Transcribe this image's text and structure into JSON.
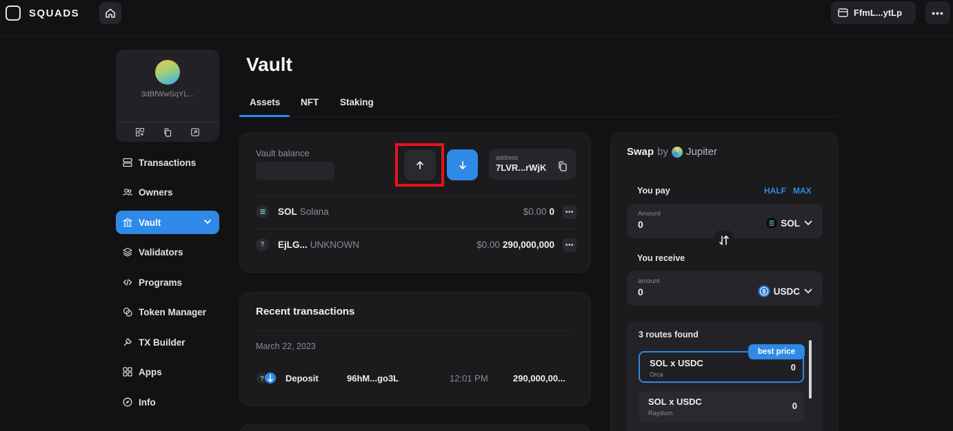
{
  "topbar": {
    "brand": "SQUADS",
    "wallet_label": "FfmL...ytLp"
  },
  "profile": {
    "address": "3dBfWwSqYL..."
  },
  "sidebar": {
    "items": [
      {
        "label": "Transactions",
        "icon": "stack-icon"
      },
      {
        "label": "Owners",
        "icon": "users-icon"
      },
      {
        "label": "Vault",
        "icon": "bank-icon"
      },
      {
        "label": "Validators",
        "icon": "layers-icon"
      },
      {
        "label": "Programs",
        "icon": "code-icon"
      },
      {
        "label": "Token Manager",
        "icon": "coins-icon"
      },
      {
        "label": "TX Builder",
        "icon": "wrench-icon"
      },
      {
        "label": "Apps",
        "icon": "grid-icon"
      },
      {
        "label": "Info",
        "icon": "compass-icon"
      }
    ],
    "active": "Vault"
  },
  "main": {
    "title": "Vault",
    "tabs": [
      {
        "label": "Assets"
      },
      {
        "label": "NFT"
      },
      {
        "label": "Staking"
      }
    ]
  },
  "balance_card": {
    "label": "Vault balance",
    "address_label": "address",
    "address_value": "7LVR...rWjK",
    "assets": [
      {
        "symbol": "SOL",
        "name": "Solana",
        "usd": "$0.00",
        "amount": "0",
        "icon_text": ""
      },
      {
        "symbol": "EjLG...",
        "name": "UNKNOWN",
        "usd": "$0.00",
        "amount": "290,000,000",
        "icon_text": "?"
      }
    ]
  },
  "recent": {
    "title": "Recent transactions",
    "date": "March 22, 2023",
    "rows": [
      {
        "type": "Deposit",
        "hash": "96hM...go3L",
        "time": "12:01 PM",
        "amount": "290,000,00..."
      }
    ]
  },
  "swap": {
    "title": "Swap",
    "by": "by",
    "provider": "Jupiter",
    "you_pay": "You pay",
    "half": "HALF",
    "max": "MAX",
    "pay_field_label": "Amount",
    "pay_value": "0",
    "pay_token": "SOL",
    "you_receive": "You receive",
    "receive_field_label": "amount",
    "receive_value": "0",
    "receive_token": "USDC",
    "routes_title": "3 routes found",
    "best_badge": "best price",
    "routes": [
      {
        "pair": "SOL x USDC",
        "dex": "Orca",
        "out": "0"
      },
      {
        "pair": "SOL x USDC",
        "dex": "Raydium",
        "out": "0"
      }
    ]
  },
  "colors": {
    "accent": "#2e8ae6",
    "highlight": "#e3141c",
    "background": "#121214"
  }
}
